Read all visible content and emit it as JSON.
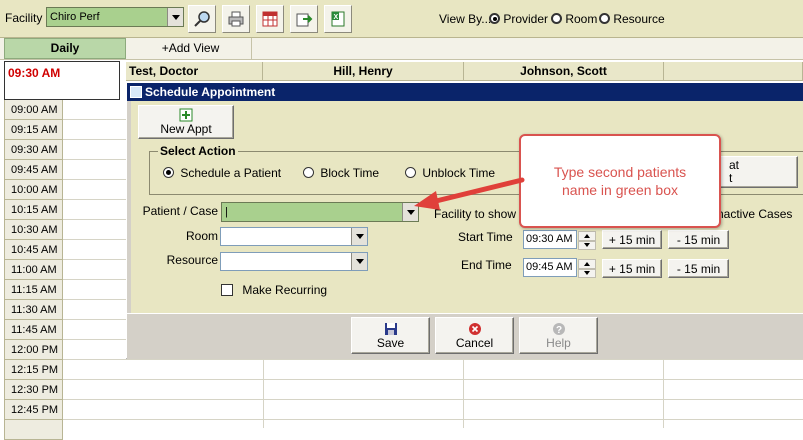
{
  "toolbar": {
    "facility_label": "Facility",
    "facility_value": "Chiro Perf",
    "view_by_label": "View By...",
    "view_options": [
      "Provider",
      "Room",
      "Resource"
    ],
    "view_selected": "Provider",
    "icons": [
      "search-icon",
      "printer-icon",
      "calendar-grid-icon",
      "export-icon",
      "excel-icon"
    ]
  },
  "tabs": {
    "daily": "Daily",
    "add_view": "+Add View"
  },
  "calendar": {
    "current_time": "09:30 AM",
    "providers": [
      "Test, Doctor",
      "Hill, Henry",
      "Johnson, Scott"
    ],
    "times": [
      "09:00 AM",
      "09:15 AM",
      "09:30 AM",
      "09:45 AM",
      "10:00 AM",
      "10:15 AM",
      "10:30 AM",
      "10:45 AM",
      "11:00 AM",
      "11:15 AM",
      "11:30 AM",
      "11:45 AM",
      "12:00 PM",
      "12:15 PM",
      "12:30 PM",
      "12:45 PM"
    ]
  },
  "dialog": {
    "title": "Schedule Appointment",
    "new_appt": "New Appt",
    "select_action": "Select Action",
    "actions": [
      "Schedule a Patient",
      "Block Time",
      "Unblock Time"
    ],
    "action_selected": "Schedule a Patient",
    "repeat_button_partial": "at",
    "repeat_button_partial2": "t",
    "patient_case_label": "Patient / Case",
    "patient_case_value": "|",
    "room_label": "Room",
    "resource_label": "Resource",
    "make_recurring": "Make Recurring",
    "facility_to_show_label": "Facility to show",
    "inactive_cases_label": "nactive Cases",
    "start_time_label": "Start Time",
    "start_time_value": "09:30 AM",
    "end_time_label": "End Time",
    "end_time_value": "09:45 AM",
    "plus15": "+ 15 min",
    "minus15": "- 15 min",
    "save": "Save",
    "cancel": "Cancel",
    "help": "Help"
  },
  "callout": {
    "text": "Type second patients name in green box"
  },
  "colors": {
    "accent_green": "#a9d08e",
    "title_bar": "#0a246a",
    "callout_red": "#d9534f",
    "time_red": "#d00000"
  }
}
